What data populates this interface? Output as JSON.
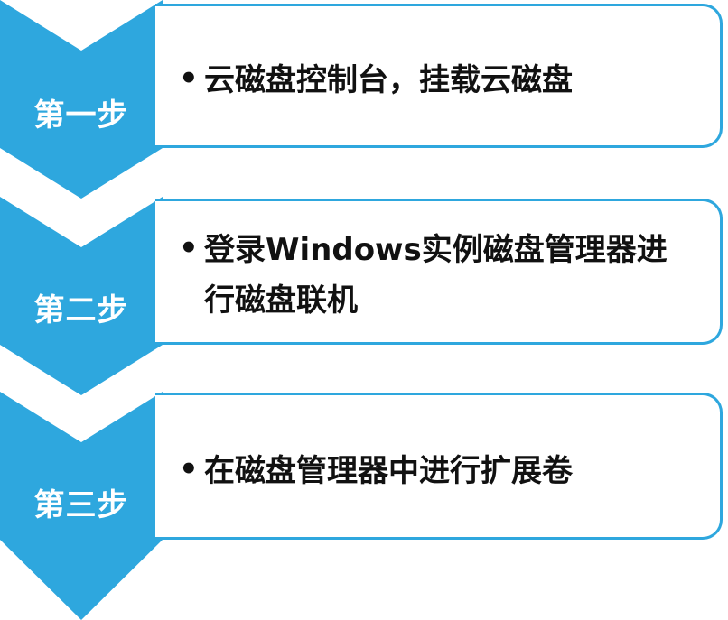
{
  "steps": [
    {
      "label": "第一步",
      "text": "云磁盘控制台，挂载云磁盘"
    },
    {
      "label": "第二步",
      "text_line1": "登录Windows实例磁盘管理器进",
      "text_line2": "行磁盘联机"
    },
    {
      "label": "第三步",
      "text": "在磁盘管理器中进行扩展卷"
    }
  ],
  "colors": {
    "chevron": "#2ea7de",
    "border": "#2ea7de",
    "text": "#111111",
    "label_text": "#ffffff"
  }
}
